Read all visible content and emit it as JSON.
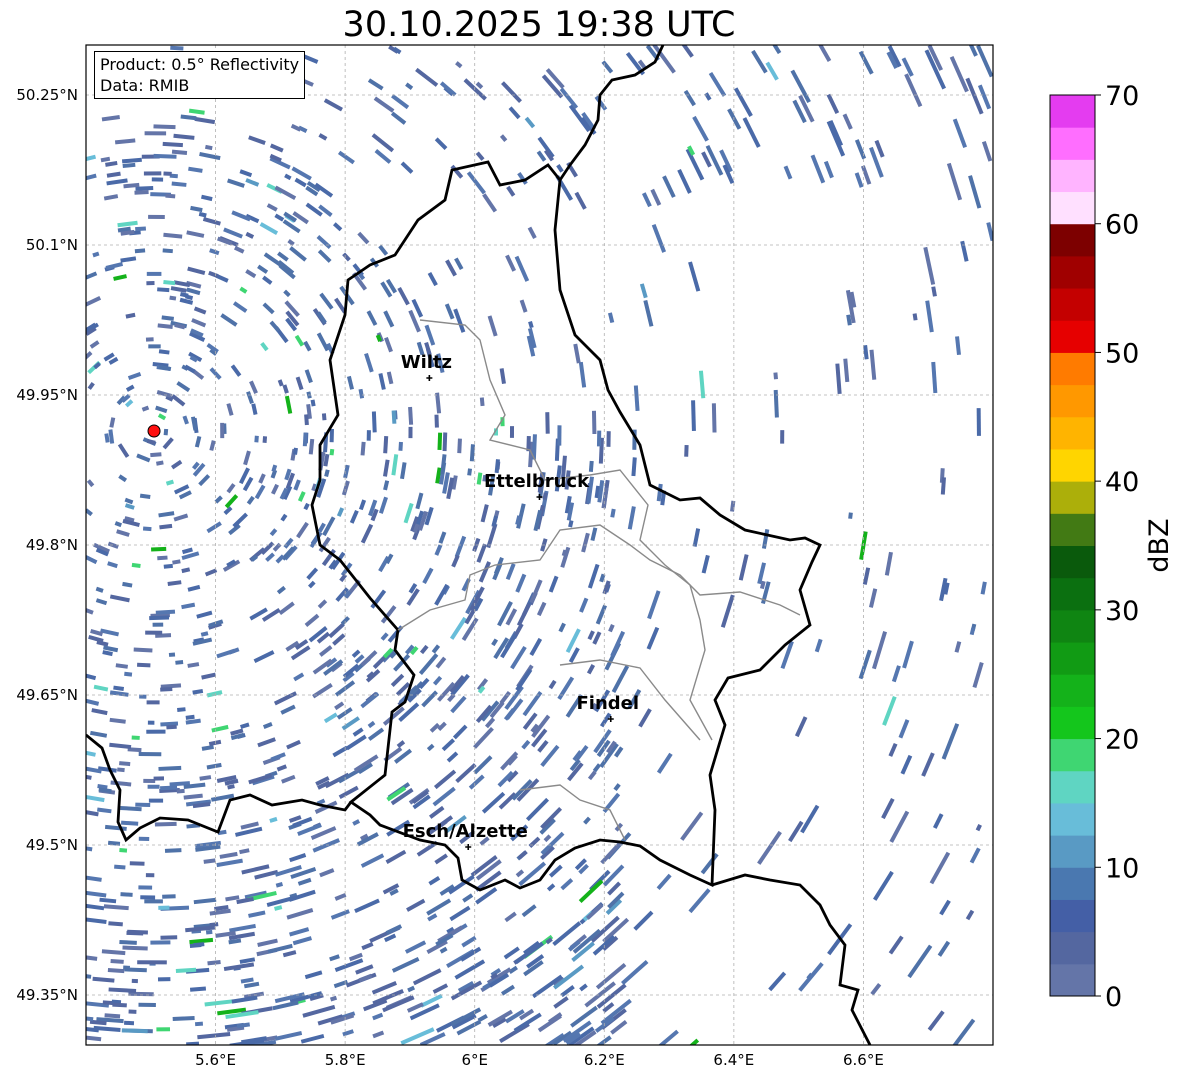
{
  "title": "30.10.2025 19:38 UTC",
  "info": {
    "product": "Product: 0.5° Reflectivity",
    "source": "Data: RMIB"
  },
  "map": {
    "lon_range": [
      5.4,
      6.8
    ],
    "lat_range": [
      49.3,
      50.3
    ],
    "lat_ticks": [
      {
        "value": 50.25,
        "label": "50.25°N"
      },
      {
        "value": 50.1,
        "label": "50.1°N"
      },
      {
        "value": 49.95,
        "label": "49.95°N"
      },
      {
        "value": 49.8,
        "label": "49.8°N"
      },
      {
        "value": 49.65,
        "label": "49.65°N"
      },
      {
        "value": 49.5,
        "label": "49.5°N"
      },
      {
        "value": 49.35,
        "label": "49.35°N"
      }
    ],
    "lon_ticks": [
      {
        "value": 5.6,
        "label": "5.6°E"
      },
      {
        "value": 5.8,
        "label": "5.8°E"
      },
      {
        "value": 6.0,
        "label": "6°E"
      },
      {
        "value": 6.2,
        "label": "6.2°E"
      },
      {
        "value": 6.4,
        "label": "6.4°E"
      },
      {
        "value": 6.6,
        "label": "6.6°E"
      }
    ],
    "radar_site": {
      "lon": 5.505,
      "lat": 49.914
    },
    "cities": [
      {
        "name": "Wiltz",
        "lon": 5.93,
        "lat": 49.967
      },
      {
        "name": "Ettelbruck",
        "lon": 6.1,
        "lat": 49.848
      },
      {
        "name": "Findel",
        "lon": 6.21,
        "lat": 49.626
      },
      {
        "name": "Esch/Alzette",
        "lon": 5.99,
        "lat": 49.498
      }
    ]
  },
  "colorbar": {
    "label": "dBZ",
    "min": 0,
    "max": 70,
    "ticks": [
      {
        "value": 0,
        "label": "0"
      },
      {
        "value": 10,
        "label": "10"
      },
      {
        "value": 20,
        "label": "20"
      },
      {
        "value": 30,
        "label": "30"
      },
      {
        "value": 40,
        "label": "40"
      },
      {
        "value": 50,
        "label": "50"
      },
      {
        "value": 60,
        "label": "60"
      },
      {
        "value": 70,
        "label": "70"
      }
    ],
    "colors": [
      "#6475a8",
      "#5467a0",
      "#445fa6",
      "#4a78b0",
      "#599ac4",
      "#68bdd9",
      "#5fd5c2",
      "#3fd672",
      "#14c61c",
      "#14b21a",
      "#119b14",
      "#0f8512",
      "#0b7010",
      "#0a5a0c",
      "#427a14",
      "#acaf0a",
      "#ffd500",
      "#ffb400",
      "#ff9800",
      "#ff7b00",
      "#e60000",
      "#c40000",
      "#a00000",
      "#7d0000",
      "#ffe0ff",
      "#ffb4ff",
      "#ff6eff",
      "#e43cf0"
    ]
  }
}
